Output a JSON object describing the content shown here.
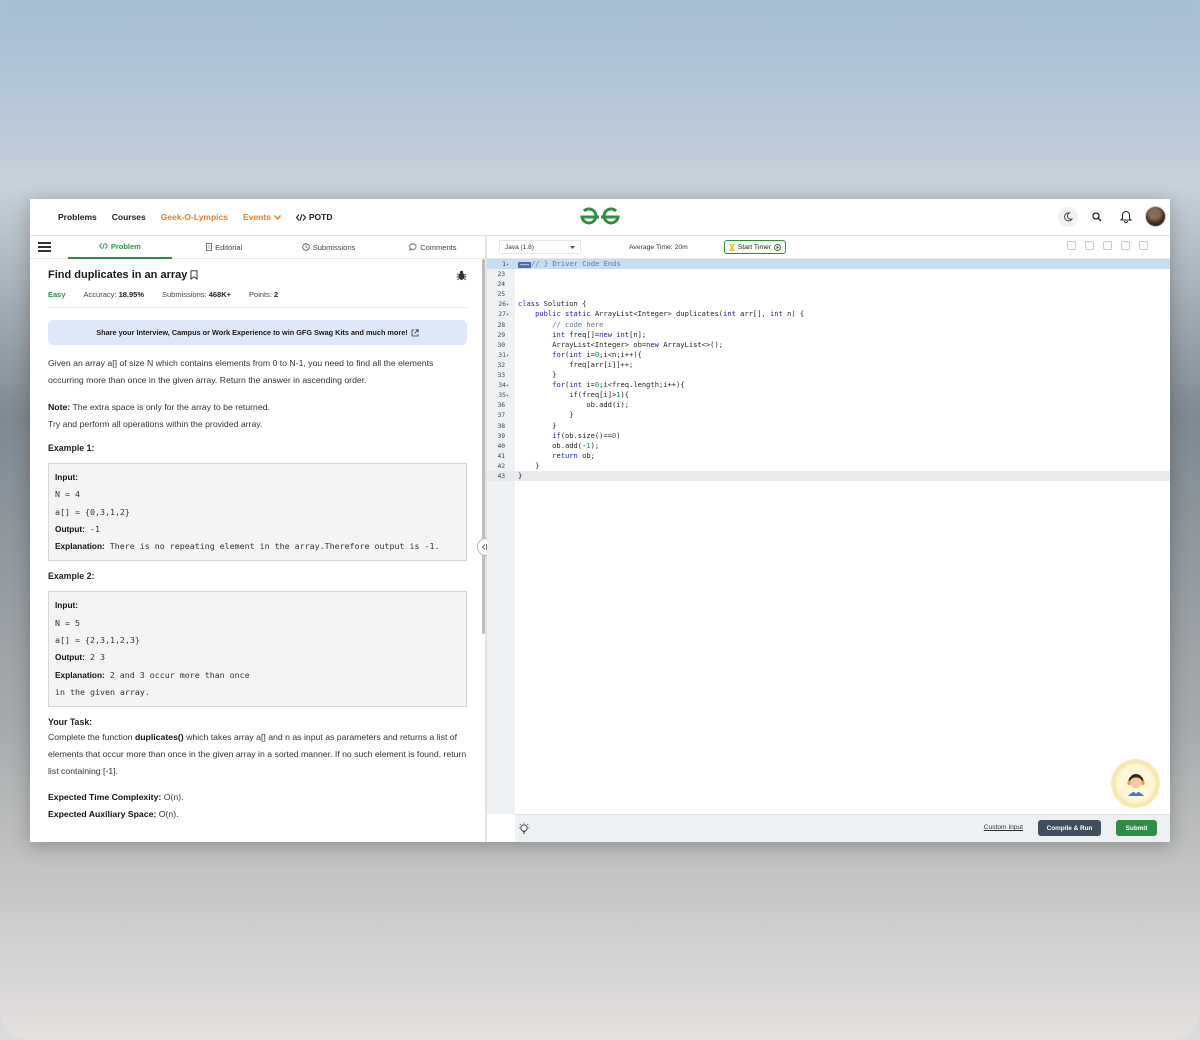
{
  "nav": {
    "links": [
      "Problems",
      "Courses",
      "Geek-O-Lympics",
      "Events",
      "POTD"
    ]
  },
  "tabs": [
    "Problem",
    "Editorial",
    "Submissions",
    "Comments"
  ],
  "problem": {
    "title": "Find duplicates in an array",
    "difficulty": "Easy",
    "accuracy_label": "Accuracy:",
    "accuracy": "18.95%",
    "submissions_label": "Submissions:",
    "submissions": "468K+",
    "points_label": "Points:",
    "points": "2",
    "banner": "Share your Interview, Campus or Work Experience to win GFG Swag Kits and much more!",
    "desc": "Given an array a[] of size N which contains elements from 0 to N-1, you need to find all the elements occurring more than once in the given array. Return the answer in ascending order.",
    "note_label": "Note:",
    "note": " The extra space is only for the array to be returned.",
    "note2": "Try and perform all operations within the provided array.",
    "example1": {
      "heading": "Example 1:",
      "input_label": "Input:",
      "n": "N = 4",
      "arr": "a[] = {0,3,1,2}",
      "output_label": "Output:",
      "output": " -1",
      "expl_label": "Explanation:",
      "expl": " There is no repeating element in the array.Therefore output is -1."
    },
    "example2": {
      "heading": "Example 2:",
      "input_label": "Input:",
      "n": "N = 5",
      "arr": "a[] = {2,3,1,2,3}",
      "output_label": "Output:",
      "output": " 2 3",
      "expl_label": "Explanation:",
      "expl": " 2 and 3 occur more than once",
      "expl2": "in the given array."
    },
    "task_heading": "Your Task:",
    "task_pre": "Complete the function ",
    "task_fn": "duplicates()",
    "task_post": " which takes array a[] and n as input as parameters and returns a list of elements that occur more than once in the given array in a sorted manner. If no such element is found, return list containing [-1].",
    "time_label": "Expected Time Complexity:",
    "time": " O(n).",
    "space_label": "Expected Auxiliary Space:",
    "space": " O(n)."
  },
  "editor": {
    "language": "Java (1.8)",
    "avg_time": "Average Time: 20m",
    "timer": "Start Timer",
    "custom_input": "Custom Input",
    "compile": "Compile & Run",
    "submit": "Submit",
    "lines": [
      {
        "n": "1",
        "fold": true,
        "t": "// } Driver Code Ends",
        "hl": "hl"
      },
      {
        "n": "23",
        "t": ""
      },
      {
        "n": "24",
        "t": ""
      },
      {
        "n": "25",
        "t": ""
      },
      {
        "n": "26",
        "fold": true,
        "t": "class Solution {"
      },
      {
        "n": "27",
        "fold": true,
        "t": "    public static ArrayList<Integer> duplicates(int arr[], int n) {"
      },
      {
        "n": "28",
        "t": "        // code here"
      },
      {
        "n": "29",
        "t": "        int freq[]=new int[n];"
      },
      {
        "n": "30",
        "t": "        ArrayList<Integer> ob=new ArrayList<>();"
      },
      {
        "n": "31",
        "fold": true,
        "t": "        for(int i=0;i<n;i++){"
      },
      {
        "n": "32",
        "t": "            freq[arr[i]]++;"
      },
      {
        "n": "33",
        "t": "        }"
      },
      {
        "n": "34",
        "fold": true,
        "t": "        for(int i=0;i<freq.length;i++){"
      },
      {
        "n": "35",
        "fold": true,
        "t": "            if(freq[i]>1){"
      },
      {
        "n": "36",
        "t": "                ob.add(i);"
      },
      {
        "n": "37",
        "t": "            }"
      },
      {
        "n": "38",
        "t": "        }"
      },
      {
        "n": "39",
        "t": "        if(ob.size()==0)"
      },
      {
        "n": "40",
        "t": "        ob.add(-1);"
      },
      {
        "n": "41",
        "t": "        return ob;"
      },
      {
        "n": "42",
        "t": "    }"
      },
      {
        "n": "43",
        "t": "}",
        "hl": "hl2"
      }
    ]
  }
}
